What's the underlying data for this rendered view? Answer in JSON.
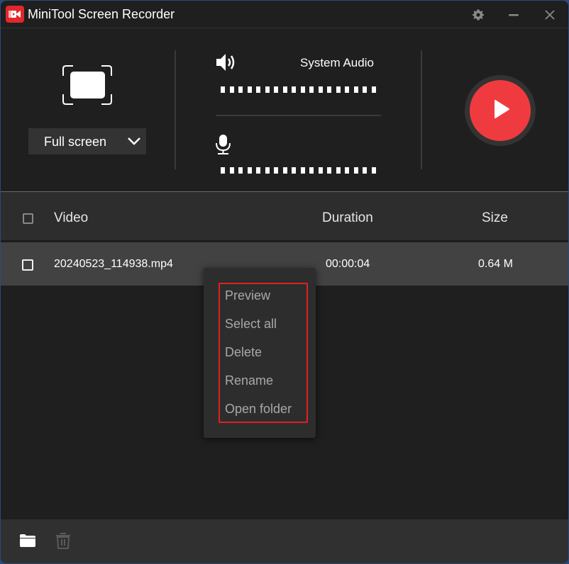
{
  "app": {
    "title": "MiniTool Screen Recorder",
    "brand_color": "#e0282b",
    "icons": {
      "logo": "camera-icon",
      "settings": "gear-icon",
      "minimize": "minimize-icon",
      "close": "close-icon"
    }
  },
  "capture": {
    "region_icon": "fullscreen-frame-icon",
    "mode": "Full screen",
    "mode_icon": "chevron-down-icon"
  },
  "audio": {
    "system_audio_label": "System Audio",
    "system_icon": "speaker-icon",
    "mic_icon": "microphone-icon",
    "level_segments": 18
  },
  "record": {
    "icon": "play-icon",
    "color": "#ef3b3f"
  },
  "list": {
    "columns": {
      "video": "Video",
      "duration": "Duration",
      "size": "Size"
    },
    "rows": [
      {
        "name": "20240523_114938.mp4",
        "duration": "00:00:04",
        "size": "0.64 M"
      }
    ]
  },
  "context_menu": {
    "items": [
      "Preview",
      "Select all",
      "Delete",
      "Rename",
      "Open folder"
    ],
    "highlight_color": "#e0221f"
  },
  "bottom_bar": {
    "icons": [
      "folder-icon",
      "trash-icon"
    ]
  }
}
